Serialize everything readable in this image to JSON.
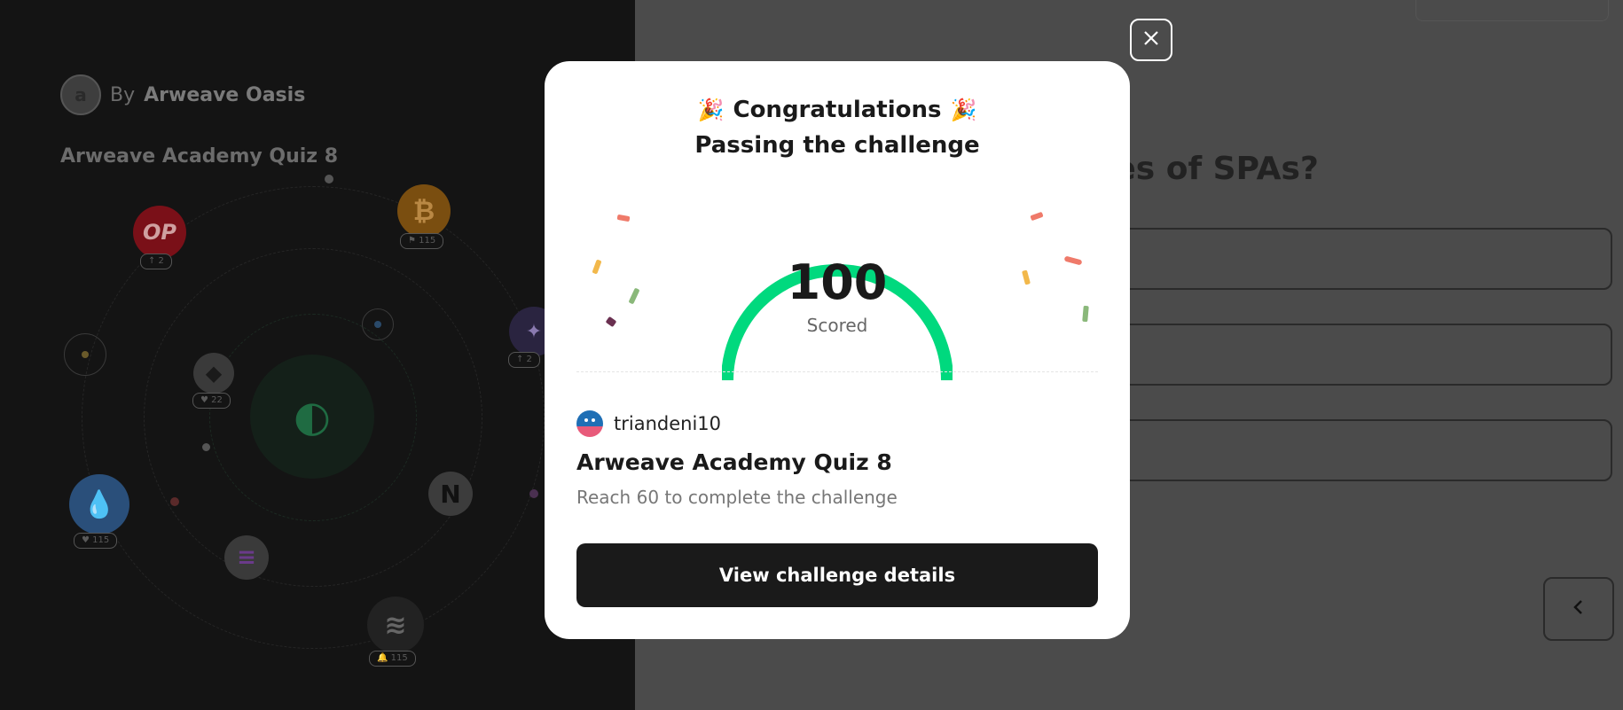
{
  "background": {
    "by_prefix": "By",
    "author": "Arweave Oasis",
    "logo_letter": "a",
    "quiz_title": "Arweave Academy Quiz 8",
    "question_fragment": "ies of SPAs?",
    "coins": [
      {
        "name": "op-coin",
        "label": "OP",
        "badge": "↑ 2"
      },
      {
        "name": "bitcoin-coin",
        "label": "₿",
        "badge": "⚑ 115"
      },
      {
        "name": "ethereum-coin",
        "label": "◆",
        "badge": "♥ 22"
      },
      {
        "name": "sui-coin",
        "label": "💧",
        "badge": "♥ 115"
      },
      {
        "name": "solana-coin",
        "label": "≡",
        "badge": ""
      },
      {
        "name": "near-coin",
        "label": "N",
        "badge": ""
      },
      {
        "name": "aptos-coin",
        "label": "≋",
        "badge": "🔔 115"
      },
      {
        "name": "partial-coin",
        "label": "✦",
        "badge": "↑ 2"
      }
    ],
    "back_icon": "chevron-left-icon"
  },
  "modal": {
    "close_icon": "close-icon",
    "party_icon": "🎉",
    "congrats": "Congratulations",
    "subtitle": "Passing the challenge",
    "score": "100",
    "score_label": "Scored",
    "score_fraction": 1.0,
    "gauge_color": "#00d97e",
    "username": "triandeni10",
    "challenge_title": "Arweave Academy Quiz 8",
    "challenge_desc": "Reach 60 to complete the challenge",
    "cta": "View challenge details"
  }
}
